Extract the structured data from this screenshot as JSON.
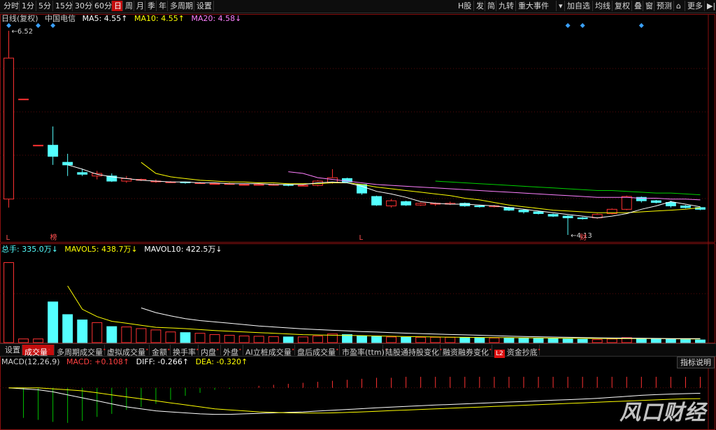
{
  "toolbar": {
    "left": [
      "分时",
      "1分",
      "5分",
      "15分",
      "30分",
      "60分",
      "日",
      "周",
      "月",
      "季",
      "年",
      "多周期",
      "设置"
    ],
    "active_index": 6,
    "right": [
      "H股",
      "发",
      "简",
      "九转",
      "重大事件",
      "▾",
      "加自选",
      "均线",
      "复权",
      "叠",
      "窗",
      "预测",
      "⌂",
      "更多",
      "▶|"
    ]
  },
  "main_legend": {
    "period": "日线(复权)",
    "name": "中国电信",
    "ma5_label": "MA5: 4.55↑",
    "ma10_label": "MA10: 4.55↑",
    "ma20_label": "MA20: 4.58↓"
  },
  "volume_legend": {
    "total_label": "总手: 335.0万↓",
    "mavol5_label": "MAVOL5: 438.7万↓",
    "mavol10_label": "MAVOL10: 422.5万↓"
  },
  "macd_legend": {
    "params": "MACD(12,26,9)",
    "macd_label": "MACD: +0.108↑",
    "diff_label": "DIFF: -0.266↑",
    "dea_label": "DEA: -0.320↑"
  },
  "indicator_tabs": [
    "设置",
    "成交量",
    "多周期成交量",
    "虚拟成交量",
    "金额",
    "换手率",
    "内盘",
    "外盘",
    "AI立桩成交量",
    "盘后成交量",
    "市盈率(ttm)",
    "陆股通持股变化",
    "融资融券变化",
    "资金抄底"
  ],
  "indicator_active_index": 1,
  "l2_badge": "L2",
  "explain_button": "指标说明",
  "watermark": "风口财经",
  "colors": {
    "up": "#ff3232",
    "down": "#54ffff",
    "ma5": "#ffffff",
    "ma10": "#ffff00",
    "ma20": "#ff80ff",
    "ma60": "#00d000",
    "diff": "#ffffff",
    "dea": "#ffff00"
  },
  "chart_data": {
    "type": "candlestick",
    "max_price_label": "6.52",
    "min_price_label": "4.13",
    "bottom_markers": [
      {
        "index": 0,
        "text": "L",
        "color": "#ff5050"
      },
      {
        "index": 3,
        "text": "榜",
        "color": "#ff5050"
      },
      {
        "index": 24,
        "text": "L",
        "color": "#ff5050"
      },
      {
        "index": 39,
        "text": "财",
        "color": "#ff5050"
      }
    ],
    "event_marker_indices": [
      0,
      2,
      3,
      38,
      39,
      43
    ],
    "candles": [
      [
        4.55,
        6.52,
        4.45,
        6.2,
        1200
      ],
      [
        5.72,
        5.72,
        5.72,
        5.72,
        55
      ],
      [
        5.18,
        5.18,
        5.18,
        5.18,
        55
      ],
      [
        5.18,
        5.4,
        4.95,
        5.05,
        610
      ],
      [
        4.98,
        5.08,
        4.82,
        4.95,
        420
      ],
      [
        4.86,
        4.9,
        4.82,
        4.84,
        340
      ],
      [
        4.82,
        4.88,
        4.78,
        4.85,
        300
      ],
      [
        4.82,
        4.85,
        4.75,
        4.76,
        240
      ],
      [
        4.76,
        4.82,
        4.74,
        4.79,
        235
      ],
      [
        4.77,
        4.79,
        4.76,
        4.78,
        210
      ],
      [
        4.76,
        4.78,
        4.74,
        4.76,
        190
      ],
      [
        4.75,
        4.76,
        4.74,
        4.75,
        160
      ],
      [
        4.75,
        4.75,
        4.73,
        4.74,
        150
      ],
      [
        4.74,
        4.75,
        4.73,
        4.74,
        140
      ],
      [
        4.73,
        4.74,
        4.72,
        4.73,
        120
      ],
      [
        4.73,
        4.74,
        4.72,
        4.73,
        110
      ],
      [
        4.72,
        4.73,
        4.71,
        4.72,
        100
      ],
      [
        4.72,
        4.73,
        4.71,
        4.72,
        95
      ],
      [
        4.72,
        4.73,
        4.71,
        4.72,
        90
      ],
      [
        4.72,
        4.73,
        4.7,
        4.71,
        85
      ],
      [
        4.71,
        4.72,
        4.7,
        4.71,
        85
      ],
      [
        4.71,
        4.77,
        4.7,
        4.76,
        100
      ],
      [
        4.74,
        4.9,
        4.73,
        4.8,
        130
      ],
      [
        4.79,
        4.8,
        4.74,
        4.75,
        120
      ],
      [
        4.72,
        4.72,
        4.6,
        4.62,
        100
      ],
      [
        4.58,
        4.59,
        4.47,
        4.48,
        90
      ],
      [
        4.47,
        4.55,
        4.45,
        4.53,
        85
      ],
      [
        4.52,
        4.53,
        4.47,
        4.48,
        80
      ],
      [
        4.48,
        4.51,
        4.47,
        4.5,
        80
      ],
      [
        4.49,
        4.51,
        4.47,
        4.5,
        80
      ],
      [
        4.49,
        4.52,
        4.48,
        4.5,
        80
      ],
      [
        4.5,
        4.51,
        4.46,
        4.47,
        75
      ],
      [
        4.47,
        4.48,
        4.45,
        4.46,
        70
      ],
      [
        4.46,
        4.48,
        4.45,
        4.47,
        70
      ],
      [
        4.45,
        4.46,
        4.41,
        4.42,
        70
      ],
      [
        4.42,
        4.43,
        4.38,
        4.4,
        70
      ],
      [
        4.4,
        4.41,
        4.37,
        4.38,
        65
      ],
      [
        4.37,
        4.38,
        4.34,
        4.35,
        60
      ],
      [
        4.35,
        4.36,
        4.13,
        4.33,
        55
      ],
      [
        4.33,
        4.34,
        4.31,
        4.32,
        50
      ],
      [
        4.33,
        4.38,
        4.32,
        4.37,
        45
      ],
      [
        4.38,
        4.44,
        4.37,
        4.43,
        55
      ],
      [
        4.43,
        4.59,
        4.42,
        4.58,
        75
      ],
      [
        4.57,
        4.58,
        4.51,
        4.53,
        60
      ],
      [
        4.53,
        4.54,
        4.5,
        4.51,
        55
      ],
      [
        4.51,
        4.53,
        4.45,
        4.47,
        50
      ],
      [
        4.47,
        4.48,
        4.44,
        4.45,
        45
      ],
      [
        4.45,
        4.46,
        4.42,
        4.43,
        40
      ]
    ],
    "ma5": [
      null,
      null,
      null,
      null,
      4.95,
      4.9,
      4.84,
      4.81,
      4.79,
      4.77,
      4.76,
      4.75,
      4.75,
      4.74,
      4.74,
      4.73,
      4.73,
      4.73,
      4.72,
      4.72,
      4.72,
      4.74,
      4.75,
      4.74,
      4.7,
      4.64,
      4.61,
      4.57,
      4.52,
      4.5,
      4.49,
      4.49,
      4.48,
      4.47,
      4.45,
      4.43,
      4.41,
      4.39,
      4.37,
      4.35,
      4.33,
      4.35,
      4.38,
      4.43,
      4.47,
      4.52,
      4.49,
      4.46
    ],
    "ma10": [
      null,
      null,
      null,
      null,
      null,
      null,
      null,
      null,
      null,
      4.98,
      4.85,
      4.81,
      4.79,
      4.77,
      4.76,
      4.75,
      4.75,
      4.74,
      4.74,
      4.73,
      4.73,
      4.73,
      4.74,
      4.74,
      4.72,
      4.69,
      4.67,
      4.65,
      4.63,
      4.61,
      4.59,
      4.56,
      4.54,
      4.51,
      4.48,
      4.46,
      4.44,
      4.42,
      4.41,
      4.4,
      4.39,
      4.39,
      4.39,
      4.4,
      4.41,
      4.42,
      4.43,
      4.45
    ],
    "ma20": [
      null,
      null,
      null,
      null,
      null,
      null,
      null,
      null,
      null,
      null,
      null,
      null,
      null,
      null,
      null,
      null,
      null,
      null,
      null,
      4.87,
      4.85,
      4.8,
      4.78,
      4.76,
      4.74,
      4.72,
      4.71,
      4.7,
      4.69,
      4.68,
      4.67,
      4.66,
      4.65,
      4.64,
      4.63,
      4.62,
      4.61,
      4.6,
      4.59,
      4.58,
      4.57,
      4.57,
      4.57,
      4.56,
      4.56,
      4.55,
      4.55,
      4.54
    ],
    "ma60": [
      null,
      null,
      null,
      null,
      null,
      null,
      null,
      null,
      null,
      null,
      null,
      null,
      null,
      null,
      null,
      null,
      null,
      null,
      null,
      null,
      null,
      null,
      null,
      null,
      null,
      null,
      null,
      null,
      null,
      4.76,
      4.75,
      4.74,
      4.73,
      4.72,
      4.71,
      4.7,
      4.69,
      4.68,
      4.67,
      4.66,
      4.65,
      4.65,
      4.64,
      4.63,
      4.62,
      4.62,
      4.61,
      4.6
    ],
    "mavol5": [
      null,
      null,
      null,
      null,
      850,
      500,
      390,
      320,
      290,
      260,
      230,
      220,
      210,
      195,
      180,
      170,
      160,
      150,
      140,
      130,
      120,
      115,
      110,
      108,
      105,
      100,
      95,
      90,
      88,
      85,
      82,
      80,
      78,
      76,
      74,
      72,
      70,
      68,
      66,
      64,
      62,
      60,
      60,
      60,
      60,
      58,
      56,
      55
    ],
    "mavol10": [
      null,
      null,
      null,
      null,
      null,
      null,
      null,
      null,
      null,
      520,
      450,
      400,
      360,
      330,
      310,
      290,
      270,
      250,
      235,
      220,
      205,
      195,
      185,
      175,
      165,
      158,
      150,
      142,
      135,
      128,
      122,
      116,
      110,
      104,
      98,
      92,
      88,
      84,
      80,
      76,
      72,
      69,
      67,
      65,
      63,
      61,
      60,
      60
    ],
    "vol_max": 1300,
    "macd_hist": [
      0,
      -0.3,
      -0.32,
      -0.34,
      -0.35,
      -0.33,
      -0.29,
      -0.26,
      -0.22,
      -0.19,
      -0.16,
      -0.12,
      -0.08,
      -0.05,
      -0.02,
      -0.01,
      0.0,
      0.02,
      0.03,
      0.04,
      0.05,
      0.06,
      0.07,
      0.08,
      0.09,
      0.1,
      0.1,
      0.11,
      0.11,
      0.11,
      0.11,
      0.11,
      0.11,
      0.11,
      0.11,
      0.11,
      0.11,
      0.11,
      0.11,
      0.11,
      0.11,
      0.11,
      0.11,
      0.11,
      0.11,
      0.11,
      0.11,
      0.11
    ],
    "diff": [
      0,
      -0.01,
      -0.02,
      -0.04,
      -0.07,
      -0.1,
      -0.13,
      -0.16,
      -0.19,
      -0.21,
      -0.23,
      -0.24,
      -0.25,
      -0.26,
      -0.265,
      -0.265,
      -0.26,
      -0.255,
      -0.25,
      -0.245,
      -0.24,
      -0.232,
      -0.224,
      -0.216,
      -0.208,
      -0.2,
      -0.192,
      -0.185,
      -0.178,
      -0.172,
      -0.166,
      -0.16,
      -0.154,
      -0.148,
      -0.142,
      -0.136,
      -0.13,
      -0.124,
      -0.118,
      -0.112,
      -0.105,
      -0.095,
      -0.085,
      -0.075,
      -0.068,
      -0.062,
      -0.058,
      -0.055
    ],
    "dea": [
      0,
      0.0,
      0.0,
      -0.01,
      -0.02,
      -0.03,
      -0.05,
      -0.07,
      -0.09,
      -0.11,
      -0.13,
      -0.15,
      -0.17,
      -0.19,
      -0.21,
      -0.22,
      -0.23,
      -0.24,
      -0.245,
      -0.25,
      -0.252,
      -0.252,
      -0.25,
      -0.246,
      -0.24,
      -0.234,
      -0.228,
      -0.222,
      -0.216,
      -0.21,
      -0.204,
      -0.198,
      -0.192,
      -0.186,
      -0.18,
      -0.174,
      -0.168,
      -0.162,
      -0.156,
      -0.15,
      -0.144,
      -0.138,
      -0.132,
      -0.126,
      -0.12,
      -0.114,
      -0.11,
      -0.108
    ],
    "macd_range": [
      -0.4,
      0.2
    ]
  }
}
